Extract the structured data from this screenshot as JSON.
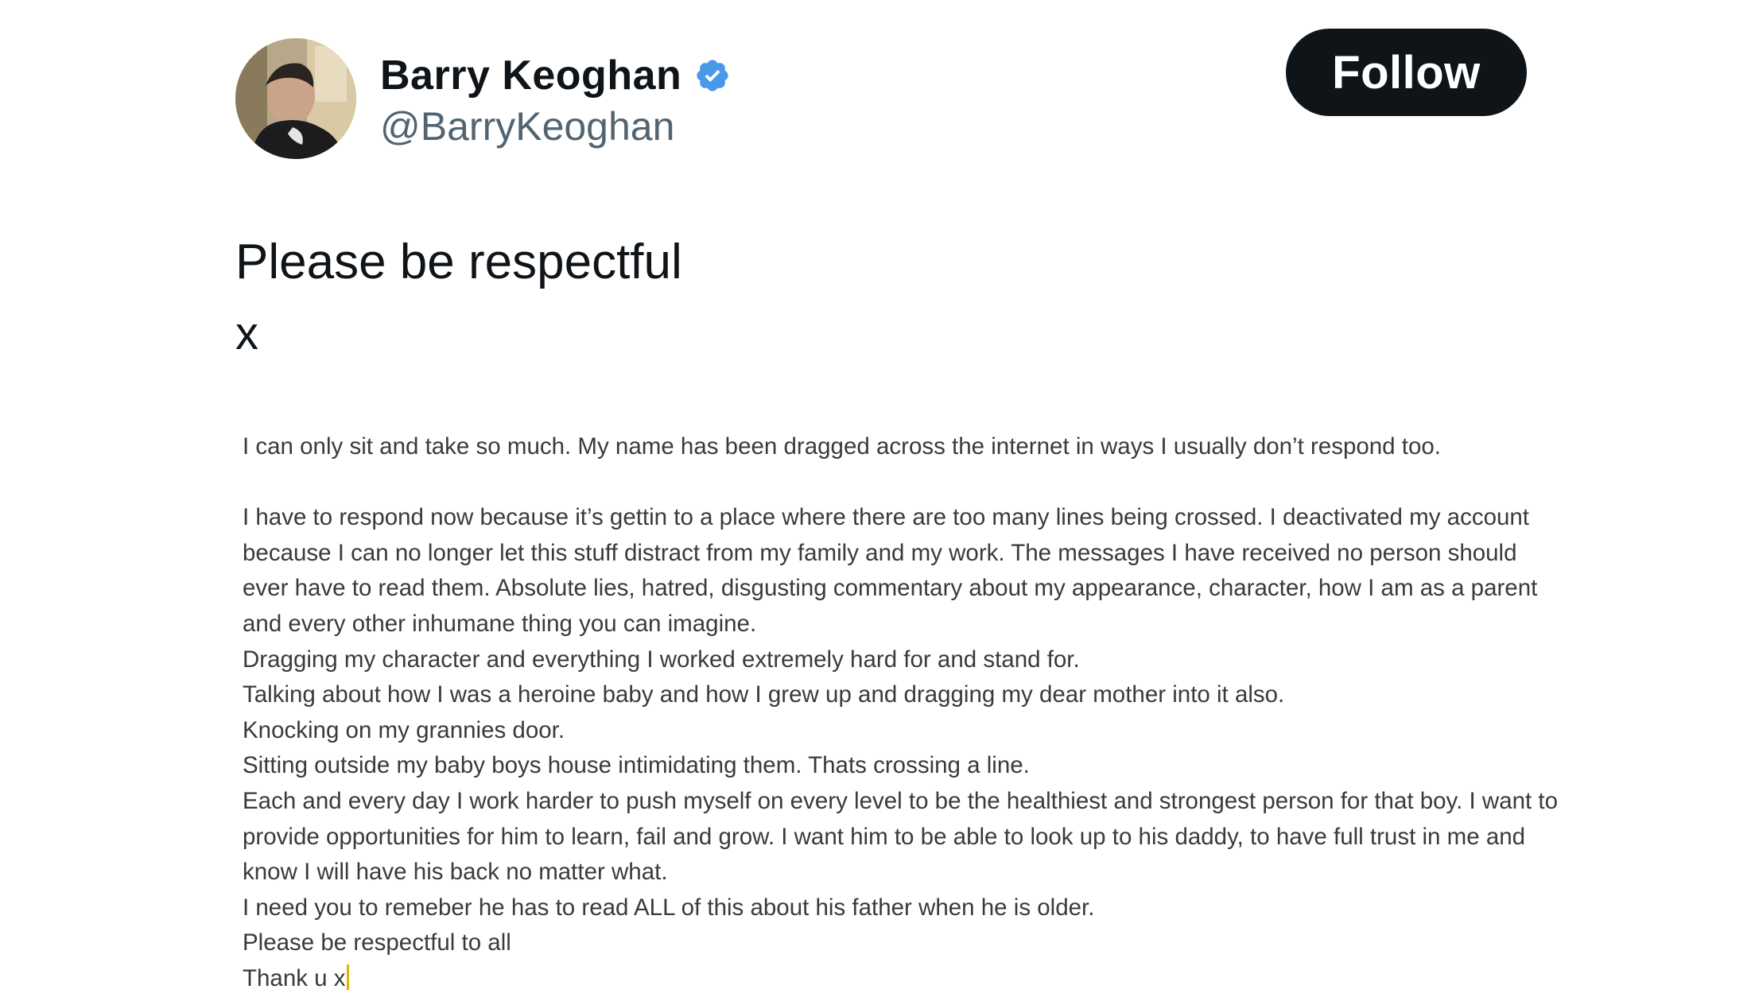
{
  "profile": {
    "display_name": "Barry Keoghan",
    "handle": "@BarryKeoghan",
    "verified": true,
    "avatar_icon": "profile-photo",
    "verified_icon": "verified-badge-icon",
    "verified_color": "#4a99e9"
  },
  "actions": {
    "follow_label": "Follow"
  },
  "post": {
    "headline": "Please be respectful",
    "headline_x": "x",
    "paragraph_1": "I can only sit and take so much. My name has been dragged across the internet in ways I usually don’t respond too.",
    "paragraph_2": "I have to respond now because it’s gettin to a place where there are too many lines being crossed. I deactivated my account because I can no longer let this stuff distract from my family and my work. The messages I have received no person should ever have to read them. Absolute lies, hatred, disgusting commentary about my appearance, character, how I am as a parent and every other inhumane thing you can imagine.",
    "line_3": "Dragging my character and everything I worked extremely hard for and stand for.",
    "line_4": "Talking about how I was a heroine baby and how I grew up and dragging my dear mother into it also.",
    "line_5": "Knocking on my grannies door.",
    "line_6": "Sitting outside my baby boys house intimidating them. Thats crossing a line.",
    "paragraph_7": "Each and every day I work harder to push myself on every level to be the healthiest and strongest person for that boy. I want to provide opportunities for him to learn, fail and grow. I want him to be able to look up to his daddy, to have full trust in me and know I will have his back no matter what.",
    "line_8": "I need you to remeber he has to read ALL of this about his father when he is older.",
    "line_9": "Please be respectful to all",
    "line_10": "Thank u x"
  },
  "colors": {
    "follow_bg": "#0f1419",
    "follow_text": "#ffffff",
    "name_text": "#0f1419",
    "handle_text": "#536471",
    "body_text": "#3a3a3a",
    "cursor": "#e0b300"
  }
}
